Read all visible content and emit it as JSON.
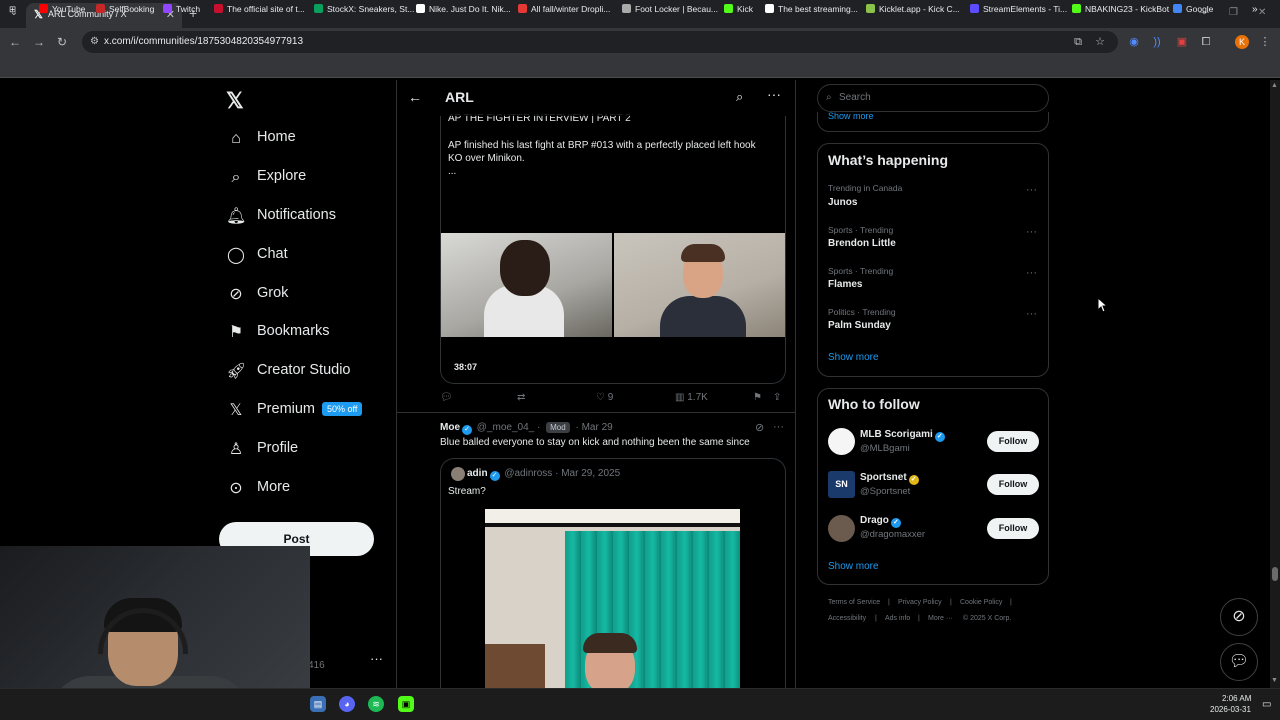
{
  "browser": {
    "tab_title": "ARL Community / X",
    "url": "x.com/i/communities/1875304820354977913",
    "bookmarks": [
      {
        "label": "YouTube",
        "color": "#ff0000"
      },
      {
        "label": "SelfBooking",
        "color": "#c62828"
      },
      {
        "label": "Twitch",
        "color": "#9146ff"
      },
      {
        "label": "The official site of t...",
        "color": "#c8102e"
      },
      {
        "label": "StockX: Sneakers, St...",
        "color": "#08a05c"
      },
      {
        "label": "Nike. Just Do It. Nik...",
        "color": "#ffffff"
      },
      {
        "label": "All fall/winter Dropli...",
        "color": "#e53935"
      },
      {
        "label": "Foot Locker | Becau...",
        "color": "#aaaaaa"
      },
      {
        "label": "Kick",
        "color": "#53fc18"
      },
      {
        "label": "The best streaming...",
        "color": "#ffffff"
      },
      {
        "label": "Kicklet.app - Kick C...",
        "color": "#8bc34a"
      },
      {
        "label": "StreamElements - Ti...",
        "color": "#5c4bff"
      },
      {
        "label": "NBAKING23 - KickBot",
        "color": "#53fc18"
      },
      {
        "label": "Google",
        "color": "#4285f4"
      }
    ]
  },
  "nav": {
    "items": [
      {
        "label": "Home",
        "icon": "home-icon"
      },
      {
        "label": "Explore",
        "icon": "search-icon"
      },
      {
        "label": "Notifications",
        "icon": "bell-icon"
      },
      {
        "label": "Chat",
        "icon": "chat-icon"
      },
      {
        "label": "Grok",
        "icon": "grok-icon"
      },
      {
        "label": "Bookmarks",
        "icon": "bookmark-icon"
      },
      {
        "label": "Creator Studio",
        "icon": "rocket-icon"
      },
      {
        "label": "Premium",
        "icon": "x-icon"
      },
      {
        "label": "Profile",
        "icon": "person-icon"
      },
      {
        "label": "More",
        "icon": "more-circle-icon"
      }
    ],
    "premium_badge": "50% off",
    "post_button": "Post",
    "account_partial": "416"
  },
  "column": {
    "title": "ARL"
  },
  "post1": {
    "title_line": "AP THE FIGHTER INTERVIEW | PART 2",
    "body_line1": "AP finished his last fight at BRP #013 with a perfectly placed left hook",
    "body_line2": "KO over Minikon.",
    "ellipsis": "...",
    "duration": "38:07",
    "likes": "9",
    "views": "1.7K"
  },
  "post2": {
    "author_name": "Moe",
    "handle": "@_moe_04_",
    "badge": "Mod",
    "date": "Mar 29",
    "body": "Blue balled everyone to stay on kick and nothing been the same since",
    "quote": {
      "author_name": "adin",
      "handle": "@adinross",
      "date": "Mar 29, 2025",
      "body": "Stream?"
    }
  },
  "right": {
    "search_placeholder": "Search",
    "prev_show_more": "Show more",
    "whats_happening": "What’s happening",
    "trends": [
      {
        "meta": "Trending in Canada",
        "name": "Junos"
      },
      {
        "meta": "Sports · Trending",
        "name": "Brendon Little"
      },
      {
        "meta": "Sports · Trending",
        "name": "Flames"
      },
      {
        "meta": "Politics · Trending",
        "name": "Palm Sunday"
      }
    ],
    "trends_show_more": "Show more",
    "who_to_follow": "Who to follow",
    "follow_suggestions": [
      {
        "name": "MLB Scorigami",
        "handle": "@MLBgami",
        "verified": "blue"
      },
      {
        "name": "Sportsnet",
        "handle": "@Sportsnet",
        "verified": "gold"
      },
      {
        "name": "Drago",
        "handle": "@dragomaxxer",
        "verified": "blue"
      }
    ],
    "follow_label": "Follow",
    "wtf_show_more": "Show more",
    "footer": {
      "terms": "Terms of Service",
      "privacy": "Privacy Policy",
      "cookie": "Cookie Policy",
      "accessibility": "Accessibility",
      "ads": "Ads info",
      "more": "More ···",
      "copyright": "© 2025 X Corp."
    }
  },
  "taskbar": {
    "time": "2:06 AM",
    "date": "2026-03-31"
  }
}
